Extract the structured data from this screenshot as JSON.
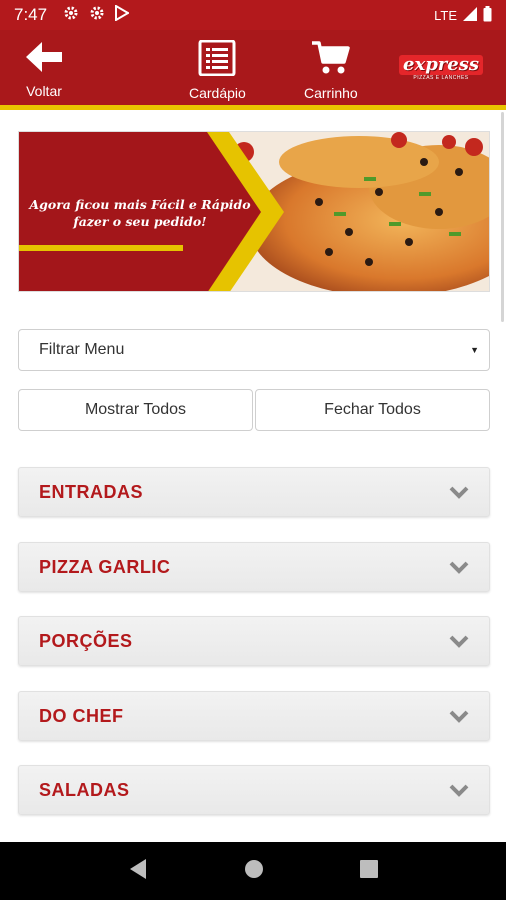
{
  "status_bar": {
    "time": "7:47",
    "network": "LTE"
  },
  "header": {
    "back_label": "Voltar",
    "menu_label": "Cardápio",
    "cart_label": "Carrinho",
    "brand_word": "express",
    "brand_sub": "PIZZAS E LANCHES"
  },
  "banner": {
    "line1": "Agora ficou mais Fácil e Rápido",
    "line2": "fazer o seu pedido!"
  },
  "filter": {
    "selected": "Filtrar Menu"
  },
  "buttons": {
    "show_all": "Mostrar Todos",
    "close_all": "Fechar Todos"
  },
  "categories": [
    {
      "title": "ENTRADAS"
    },
    {
      "title": "PIZZA GARLIC"
    },
    {
      "title": "PORÇÕES"
    },
    {
      "title": "DO CHEF"
    },
    {
      "title": "SALADAS"
    }
  ],
  "colors": {
    "brand_red": "#a9181b",
    "accent_gold": "#e9c400",
    "category_text": "#b3191c"
  }
}
